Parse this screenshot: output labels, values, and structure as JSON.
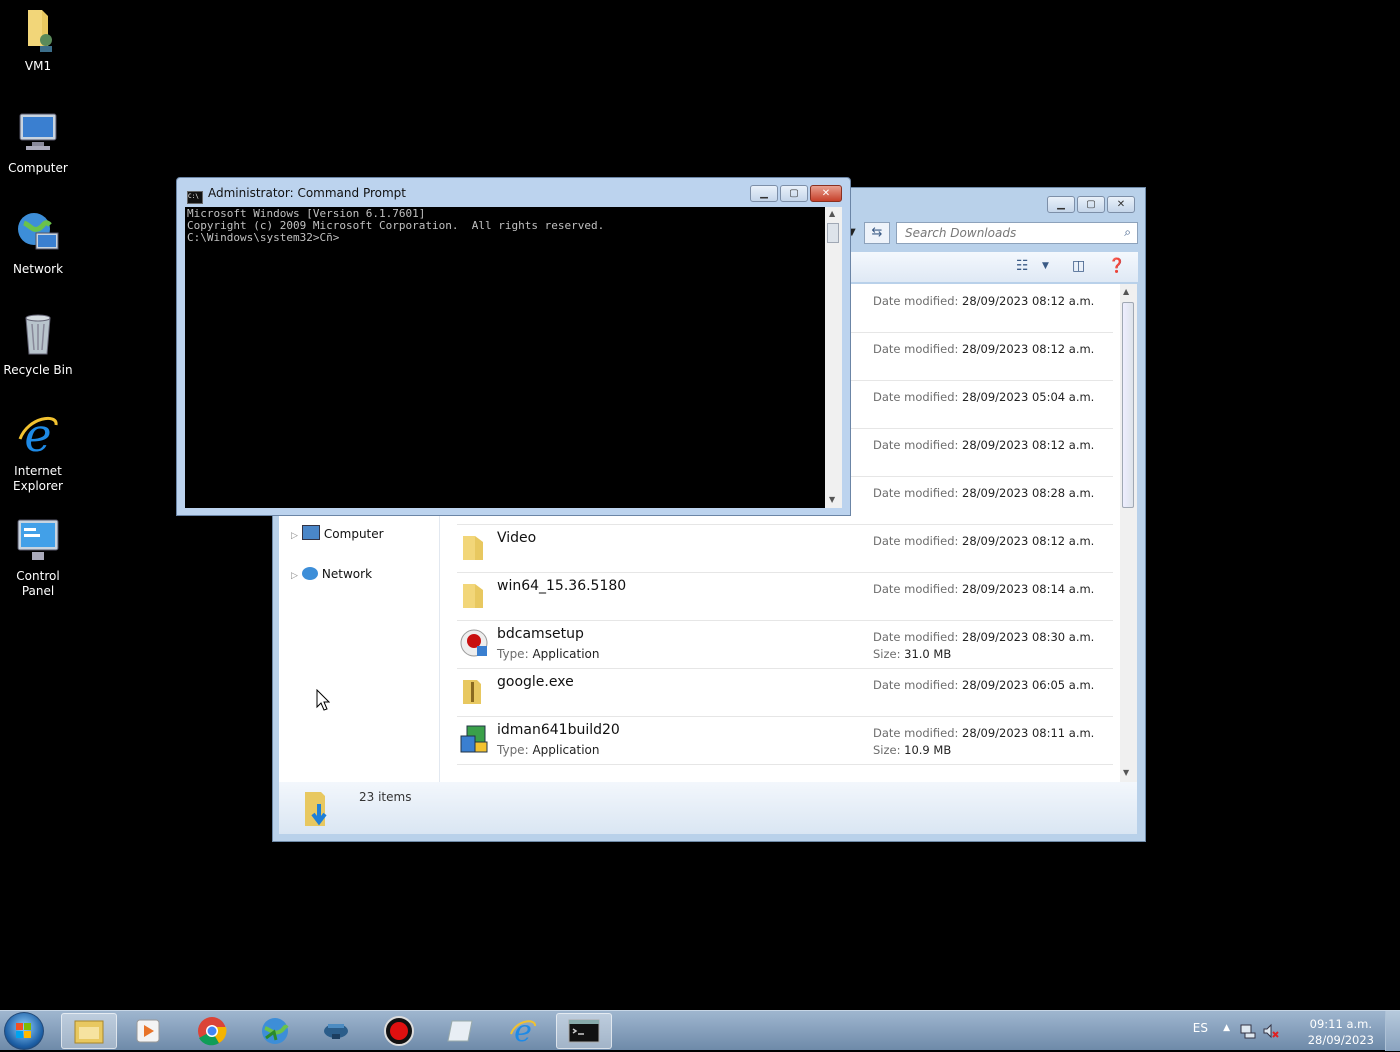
{
  "desktop": {
    "icons": [
      {
        "label": "VM1"
      },
      {
        "label": "Computer"
      },
      {
        "label": "Network"
      },
      {
        "label": "Recycle Bin"
      },
      {
        "label": "Internet Explorer"
      },
      {
        "label": "Control Panel"
      }
    ]
  },
  "cmd": {
    "title": "Administrator: Command Prompt",
    "icon_text": "C:\\",
    "lines": [
      "Microsoft Windows [Version 6.1.7601]",
      "Copyright (c) 2009 Microsoft Corporation.  All rights reserved.",
      "",
      "C:\\Windows\\system32>Cñ>"
    ]
  },
  "explorer": {
    "search_placeholder": "Search Downloads",
    "nav": [
      {
        "label": "Computer"
      },
      {
        "label": "Network"
      }
    ],
    "date_label": "Date modified:",
    "type_label": "Type:",
    "size_label": "Size:",
    "files": [
      {
        "name": "",
        "date": "28/09/2023 08:12 a.m.",
        "icon": "folder-icon"
      },
      {
        "name": "",
        "date": "28/09/2023 08:12 a.m.",
        "icon": "folder-icon"
      },
      {
        "name": "",
        "date": "28/09/2023 05:04 a.m.",
        "icon": "folder-icon"
      },
      {
        "name": "",
        "date": "28/09/2023 08:12 a.m.",
        "icon": "folder-icon"
      },
      {
        "name": "",
        "date": "28/09/2023 08:28 a.m.",
        "icon": "folder-icon"
      },
      {
        "name": "Video",
        "date": "28/09/2023 08:12 a.m.",
        "icon": "folder-icon"
      },
      {
        "name": "win64_15.36.5180",
        "date": "28/09/2023 08:14 a.m.",
        "icon": "folder-icon"
      },
      {
        "name": "bdcamsetup",
        "type": "Application",
        "date": "28/09/2023 08:30 a.m.",
        "size": "31.0 MB",
        "icon": "bandicam-app-icon"
      },
      {
        "name": "google.exe",
        "date": "28/09/2023 06:05 a.m.",
        "icon": "zip-folder-icon"
      },
      {
        "name": "idman641build20",
        "type": "Application",
        "date": "28/09/2023 08:11 a.m.",
        "size": "10.9 MB",
        "icon": "idm-app-icon"
      }
    ],
    "status": "23 items"
  },
  "taskbar": {
    "lang": "ES",
    "time": "09:11 a.m.",
    "date": "28/09/2023",
    "apps": [
      "explorer-icon",
      "media-player-icon",
      "chrome-icon",
      "globe-app-icon",
      "vm-app-icon",
      "record-app-icon",
      "blank-app-icon",
      "ie-icon",
      "cmd-icon"
    ]
  },
  "colors": {
    "desktop": "#000000",
    "window_frame": "#b9d1ea",
    "taskbar": "#8aa3bf"
  }
}
